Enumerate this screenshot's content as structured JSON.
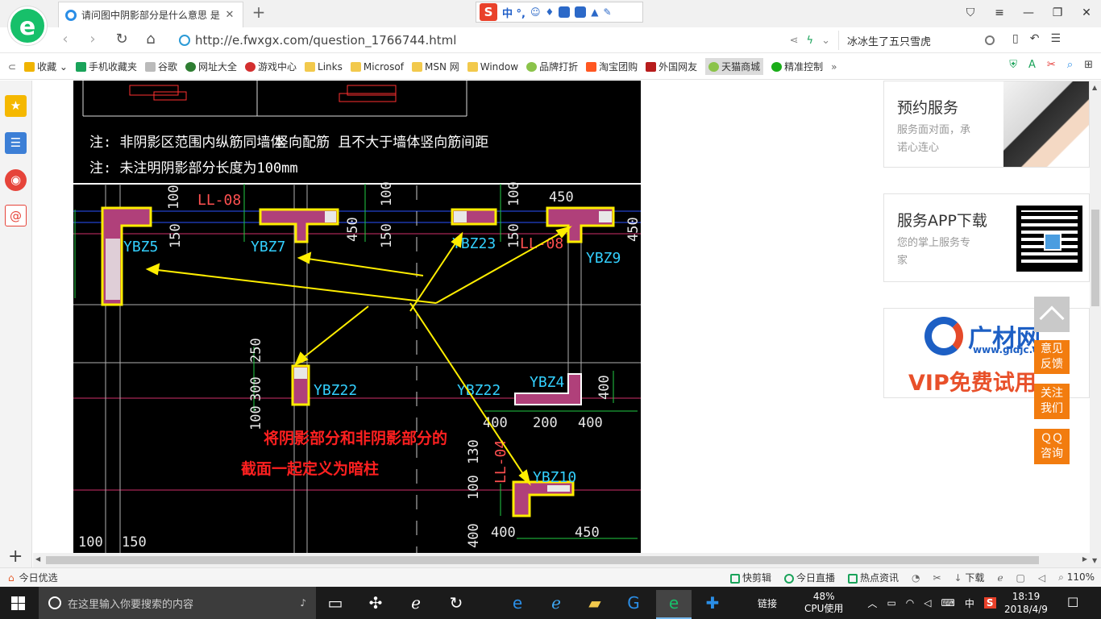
{
  "browser": {
    "tab_title": "请问图中阴影部分是什么意思 是",
    "url": "http://e.fwxgx.com/question_1766744.html",
    "search_text": "冰冰生了五只雪虎",
    "logo_letter": "e",
    "ime_label": "中 °,"
  },
  "bookmarks": [
    {
      "label": "收藏",
      "icon": "star-icon",
      "color": "#f0b400"
    },
    {
      "label": "手机收藏夹",
      "icon": "phone-icon",
      "color": "#1aa35a"
    },
    {
      "label": "谷歌",
      "icon": "page-icon",
      "color": "#aaaaaa"
    },
    {
      "label": "网址大全",
      "icon": "globe-icon",
      "color": "#2e7d32"
    },
    {
      "label": "游戏中心",
      "icon": "game-icon",
      "color": "#d32f2f"
    },
    {
      "label": "Links",
      "icon": "folder-icon",
      "color": "#f2c94c"
    },
    {
      "label": "Microsof",
      "icon": "folder-icon",
      "color": "#f2c94c"
    },
    {
      "label": "MSN 网",
      "icon": "folder-icon",
      "color": "#f2c94c"
    },
    {
      "label": "Window",
      "icon": "folder-icon",
      "color": "#f2c94c"
    },
    {
      "label": "品牌打折",
      "icon": "leaf-icon",
      "color": "#8bc34a"
    },
    {
      "label": "淘宝团购",
      "icon": "taobao-icon",
      "color": "#ff5722"
    },
    {
      "label": "外国网友",
      "icon": "bookmark-icon",
      "color": "#b71c1c"
    },
    {
      "label": "天猫商城",
      "icon": "leaf-icon",
      "color": "#8bc34a"
    },
    {
      "label": "精准控制",
      "icon": "wechat-icon",
      "color": "#1aad19"
    }
  ],
  "drawing": {
    "note1": "注: 非阴影区范围内纵筋同墙体",
    "note1b": "竖向配筋 且不大于墙体竖向筋间距",
    "note2": "注: 未注明阴影部分长度为100mm",
    "labels": {
      "ybz5": "YBZ5",
      "ybz7": "YBZ7",
      "ybz23": "YBZ23",
      "ybz9": "YBZ9",
      "ybz22a": "YBZ22",
      "ybz22b": "YBZ22",
      "ybz4": "YBZ4",
      "ybz10": "YBZ10",
      "ll08a": "LL-08",
      "ll08b": "LL-08",
      "ll04": "LL-04"
    },
    "dims": {
      "d100a": "100",
      "d100b": "100",
      "d100c": "100",
      "d450a": "450",
      "d150a": "150",
      "d150b": "150",
      "d150c": "150",
      "d450b": "450",
      "d450c": "450",
      "d250": "250",
      "d300": "300",
      "d100d": "100",
      "d400a": "400",
      "d200": "200",
      "d400b": "400",
      "d400c": "400",
      "d130": "130",
      "d100e": "100",
      "d400d": "400",
      "d400e": "400",
      "d450d": "450",
      "d100f": "100",
      "d150d": "150"
    },
    "annotation_line1": "将阴影部分和非阴影部分的",
    "annotation_line2": "截面一起定义为暗柱"
  },
  "sidebar_cards": {
    "booking_title": "预约服务",
    "booking_sub1": "服务面对面，承",
    "booking_sub2": "诺心连心",
    "app_title": "服务APP下载",
    "app_sub1": "您的掌上服务专",
    "app_sub2": "家",
    "brand_name": "广材网",
    "brand_url": "www.gldjc.com",
    "vip_text": "VIP免费试用"
  },
  "float_buttons": {
    "feedback": "意见\n反馈",
    "follow": "关注\n我们",
    "qq": "ＱＱ\n咨询"
  },
  "statusbar": {
    "left": "今日优选",
    "items": [
      "快剪辑",
      "今日直播",
      "热点资讯"
    ],
    "download": "下载",
    "zoom": "110%"
  },
  "taskbar": {
    "search_placeholder": "在这里输入你要搜索的内容",
    "links_label": "链接",
    "cpu_percent": "48%",
    "cpu_label": "CPU使用",
    "ime": "中",
    "time": "18:19",
    "date": "2018/4/9"
  }
}
